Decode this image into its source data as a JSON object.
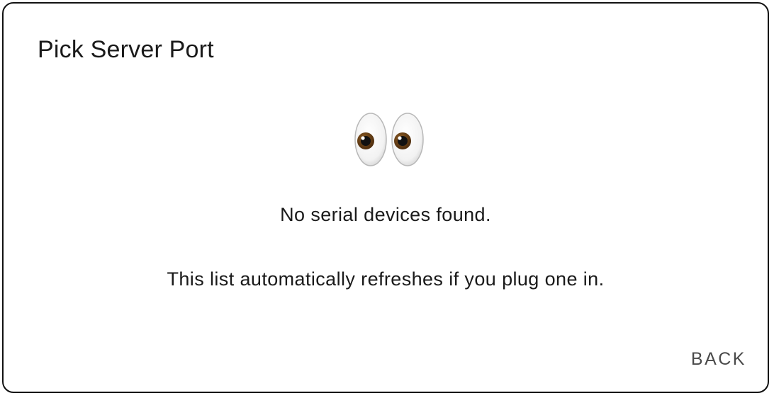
{
  "dialog": {
    "title": "Pick Server Port",
    "empty_icon": "eyes-icon",
    "empty_message": "No serial devices found.",
    "hint": "This list automatically refreshes if you plug one in.",
    "back_label": "BACK"
  },
  "colors": {
    "text": "#1a1a1a",
    "button_text": "#4a4a4a",
    "border": "#111111",
    "iris": "#5a3310"
  }
}
